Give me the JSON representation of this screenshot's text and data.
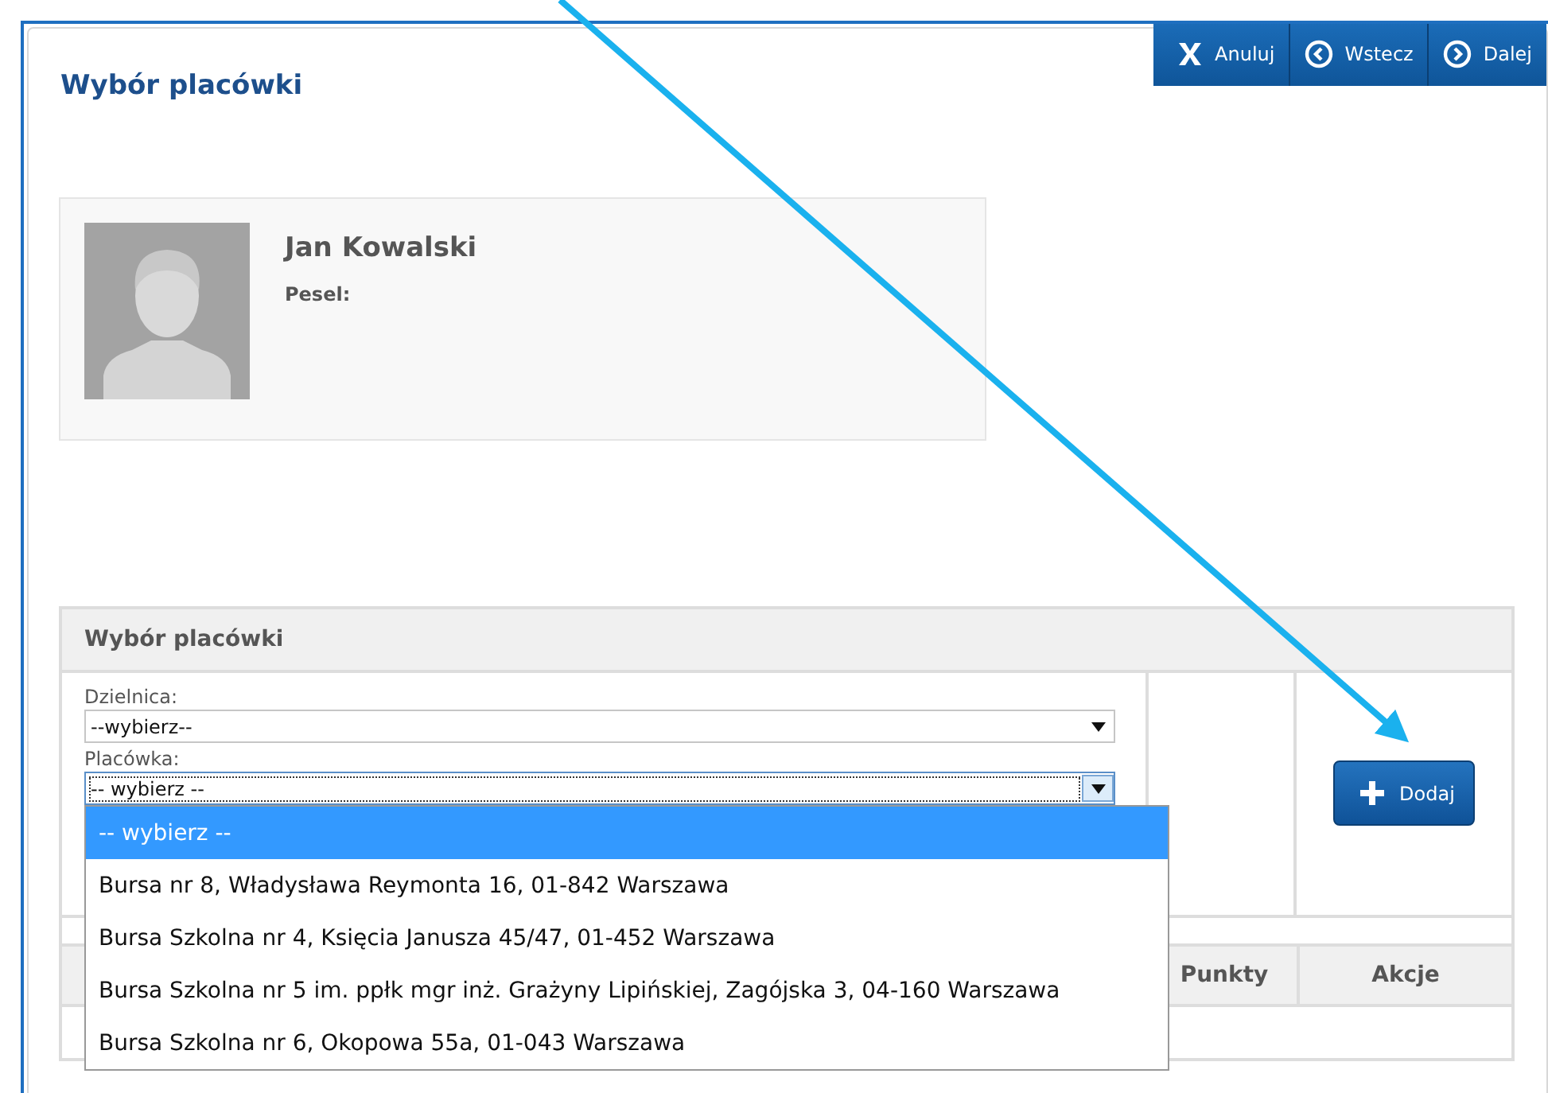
{
  "page": {
    "title": "Wybór placówki"
  },
  "nav_buttons": [
    {
      "kind": "cancel",
      "label": "Anuluj"
    },
    {
      "kind": "back",
      "label": "Wstecz"
    },
    {
      "kind": "next",
      "label": "Dalej"
    }
  ],
  "profile": {
    "name": "Jan Kowalski",
    "pesel_label": "Pesel:"
  },
  "selection_panel": {
    "title": "Wybór placówki",
    "fields": [
      {
        "label": "Dzielnica:",
        "value": "--wybierz--",
        "focused": false
      },
      {
        "label": "Placówka:",
        "value": "-- wybierz --",
        "focused": true
      }
    ],
    "add_button": "Dodaj"
  },
  "dropdown": {
    "options": [
      {
        "label": "-- wybierz --",
        "selected": true
      },
      {
        "label": "Bursa nr 8, Władysława Reymonta 16, 01-842 Warszawa",
        "selected": false
      },
      {
        "label": "Bursa Szkolna nr 4, Księcia Janusza 45/47, 01-452 Warszawa",
        "selected": false
      },
      {
        "label": "Bursa Szkolna nr 5 im. ppłk mgr inż. Grażyny Lipińskiej, Zagójska 3, 04-160 Warszawa",
        "selected": false
      },
      {
        "label": "Bursa Szkolna nr 6, Okopowa 55a, 01-043 Warszawa",
        "selected": false
      }
    ]
  },
  "table": {
    "columns": [
      "Punkty",
      "Akcje"
    ]
  }
}
